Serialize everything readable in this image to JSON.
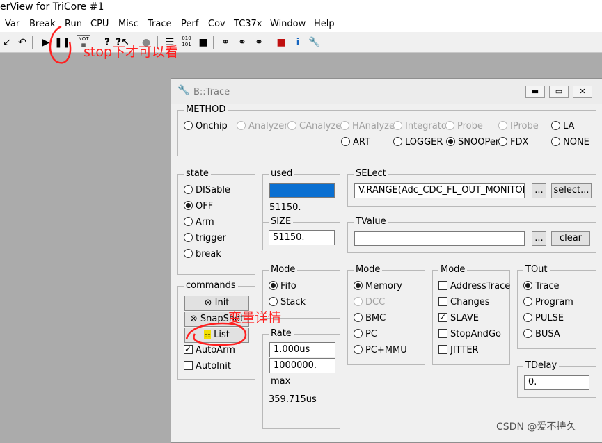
{
  "app": {
    "title": "erView for TriCore #1"
  },
  "menu": [
    "Var",
    "Break",
    "Run",
    "CPU",
    "Misc",
    "Trace",
    "Perf",
    "Cov",
    "TC37x",
    "Window",
    "Help"
  ],
  "toolbar": {
    "icons": [
      "step-icon",
      "return-icon",
      "go-icon",
      "break-icon",
      "not-icon",
      "help-icon",
      "help-arrow-icon",
      "chip-icon",
      "list-icon",
      "data-icon",
      "block-icon",
      "binoculars-1-icon",
      "binoculars-2-icon",
      "binoculars-3-icon",
      "cube-icon",
      "info-icon",
      "wrench-icon"
    ]
  },
  "trace_window": {
    "title": "B::Trace",
    "method": {
      "label": "METHOD",
      "options": [
        "Onchip",
        "Analyzer",
        "CAnalyzer",
        "HAnalyzer",
        "Integrator",
        "Probe",
        "IProbe",
        "LA",
        "ART",
        "LOGGER",
        "SNOOPer",
        "FDX",
        "NONE"
      ],
      "selected": "SNOOPer"
    },
    "state": {
      "label": "state",
      "options": [
        "DISable",
        "OFF",
        "Arm",
        "trigger",
        "break"
      ],
      "selected": "OFF"
    },
    "used": {
      "label": "used",
      "value": "51150.",
      "bar_fraction": 1.0,
      "bar_color": "#0a6fd1"
    },
    "size": {
      "label": "SIZE",
      "value": "51150."
    },
    "select": {
      "label": "SELect",
      "value": "V.RANGE(Adc_CDC_FL_OUT_MONITOR",
      "dots_label": "...",
      "select_label": "select..."
    },
    "tvalue": {
      "label": "TValue",
      "value": "",
      "dots_label": "...",
      "clear_label": "clear"
    },
    "commands": {
      "label": "commands",
      "init": "Init",
      "snapshot": "SnapShot",
      "list": "List",
      "autoarm": "AutoArm",
      "autoarm_checked": true,
      "autoinit": "AutoInit",
      "autoinit_checked": false
    },
    "mode1": {
      "label": "Mode",
      "options": [
        "Fifo",
        "Stack"
      ],
      "selected": "Fifo"
    },
    "mode2": {
      "label": "Mode",
      "options": [
        "Memory",
        "DCC",
        "BMC",
        "PC",
        "PC+MMU"
      ],
      "selected": "Memory",
      "disabled": [
        "DCC"
      ]
    },
    "mode3": {
      "label": "Mode",
      "options": [
        "AddressTrace",
        "Changes",
        "SLAVE",
        "StopAndGo",
        "JITTER"
      ],
      "checked": [
        "SLAVE"
      ]
    },
    "tout": {
      "label": "TOut",
      "options": [
        "Trace",
        "Program",
        "PULSE",
        "BUSA"
      ],
      "selected": "Trace"
    },
    "rate": {
      "label": "Rate",
      "value1": "1.000us",
      "value2": "1000000."
    },
    "max": {
      "label": "max",
      "value": "359.715us"
    },
    "tdelay": {
      "label": "TDelay",
      "value": "0."
    }
  },
  "annotations": {
    "stop_note": "stop下才可以看",
    "list_note": "变量详情",
    "watermark": "CSDN @爱不持久"
  },
  "colors": {
    "accent": "#0a6fd1",
    "annotation": "#ff2020"
  }
}
